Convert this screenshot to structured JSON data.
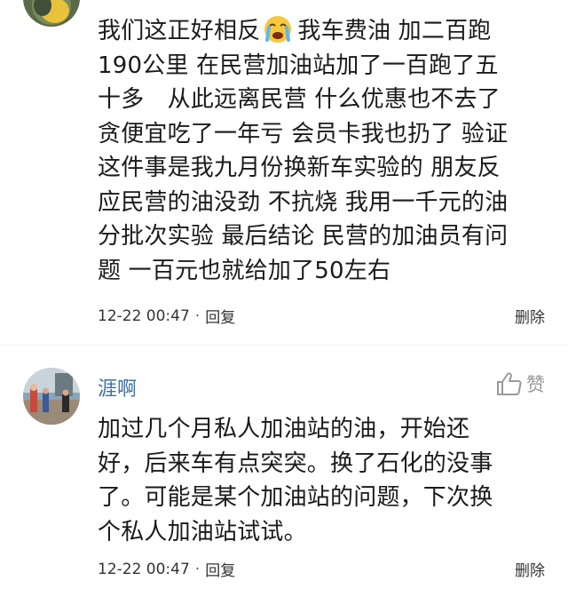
{
  "comments": [
    {
      "lines": [
        "我们这正好相反",
        "190公里 在民营加油站加了一百跑了五",
        "十多　从此远离民营 什么优惠也不去了",
        "贪便宜吃了一年亏 会员卡我也扔了 验证",
        "这件事是我九月份换新车实验的 朋友反",
        "应民营的油没劲 不抗烧 我用一千元的油",
        "分批次实验 最后结论 民营的加油员有问",
        "题 一百元也就给加了50左右"
      ],
      "line1_after_emoji": "我车费油 加二百跑",
      "emoji": "crying-face-icon",
      "time": "12-22 00:47",
      "separator": "·",
      "reply_label": "回复",
      "delete_label": "删除"
    },
    {
      "username": "涯啊",
      "like_label": "赞",
      "lines": [
        "加过几个月私人加油站的油，开始还",
        "好，后来车有点突突。换了石化的没事",
        "了。可能是某个加油站的问题，下次换",
        "个私人加油站试试。"
      ],
      "time": "12-22 00:47",
      "separator": "·",
      "reply_label": "回复",
      "delete_label": "删除"
    }
  ],
  "colors": {
    "username": "#3d6fa8",
    "text": "#1a1a1a",
    "meta": "#333333",
    "like": "#9a9a9a"
  }
}
